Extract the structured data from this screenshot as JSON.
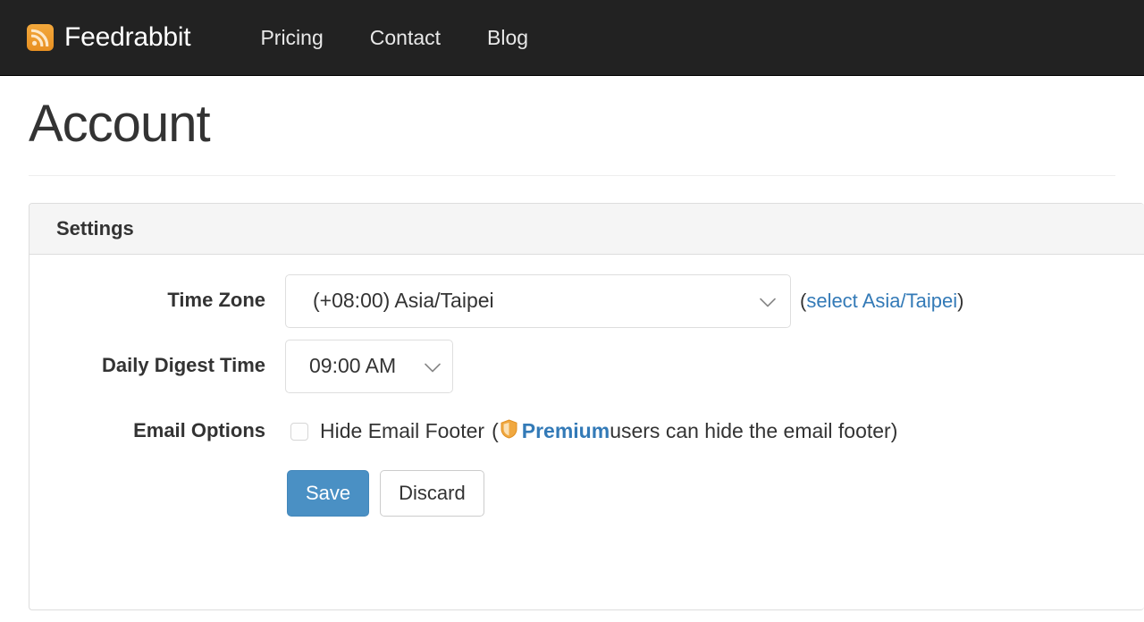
{
  "navbar": {
    "brand": "Feedrabbit",
    "brand_icon": "rss-icon",
    "background_color": "#222222",
    "icon_color": "#f0a030",
    "links": [
      {
        "label": "Pricing"
      },
      {
        "label": "Contact"
      },
      {
        "label": "Blog"
      }
    ]
  },
  "page": {
    "title": "Account"
  },
  "panel": {
    "title": "Settings",
    "fields": {
      "timezone": {
        "label": "Time Zone",
        "value": "(+08:00) Asia/Taipei",
        "note_open_paren": "(",
        "note_link": "select Asia/Taipei",
        "note_close_paren": ")"
      },
      "digest": {
        "label": "Daily Digest Time",
        "value": "09:00 AM"
      },
      "email_options": {
        "label": "Email Options",
        "checkbox_label": "Hide Email Footer",
        "checked": false,
        "note_open_paren": "(",
        "premium_badge_icon": "shield-icon",
        "premium_label": "Premium",
        "note_text": " users can hide the email footer",
        "note_close_paren": ")"
      }
    },
    "buttons": {
      "save": "Save",
      "discard": "Discard"
    }
  },
  "colors": {
    "accent_blue": "#4a90c4",
    "link_blue": "#337ab7",
    "premium_orange": "#f0a840",
    "navbar_dark": "#222222",
    "panel_header_gray": "#f5f5f5"
  }
}
